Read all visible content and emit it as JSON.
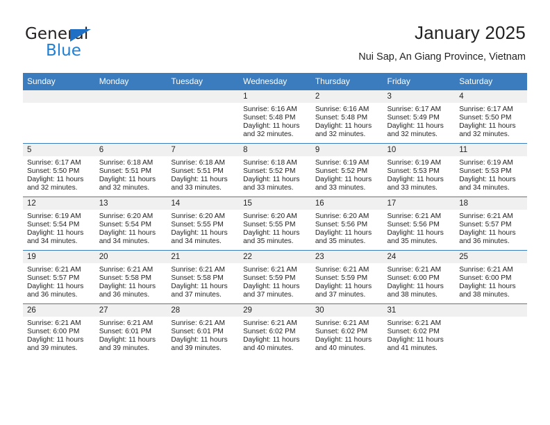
{
  "brand": {
    "name_top": "General",
    "name_bottom": "Blue",
    "triangle_color": "#1f6fc4",
    "blue_color": "#1f7fd4"
  },
  "header": {
    "title": "January 2025",
    "location": "Nui Sap, An Giang Province, Vietnam",
    "accent_color": "#3a7cbd"
  },
  "calendar": {
    "weekday_headers": [
      "Sunday",
      "Monday",
      "Tuesday",
      "Wednesday",
      "Thursday",
      "Friday",
      "Saturday"
    ],
    "labels": {
      "sunrise": "Sunrise:",
      "sunset": "Sunset:",
      "daylight": "Daylight:"
    },
    "weeks": [
      [
        {
          "day": "",
          "empty": true
        },
        {
          "day": "",
          "empty": true
        },
        {
          "day": "",
          "empty": true
        },
        {
          "day": "1",
          "sunrise": "Sunrise: 6:16 AM",
          "sunset": "Sunset: 5:48 PM",
          "daylight": "Daylight: 11 hours and 32 minutes."
        },
        {
          "day": "2",
          "sunrise": "Sunrise: 6:16 AM",
          "sunset": "Sunset: 5:48 PM",
          "daylight": "Daylight: 11 hours and 32 minutes."
        },
        {
          "day": "3",
          "sunrise": "Sunrise: 6:17 AM",
          "sunset": "Sunset: 5:49 PM",
          "daylight": "Daylight: 11 hours and 32 minutes."
        },
        {
          "day": "4",
          "sunrise": "Sunrise: 6:17 AM",
          "sunset": "Sunset: 5:50 PM",
          "daylight": "Daylight: 11 hours and 32 minutes."
        }
      ],
      [
        {
          "day": "5",
          "sunrise": "Sunrise: 6:17 AM",
          "sunset": "Sunset: 5:50 PM",
          "daylight": "Daylight: 11 hours and 32 minutes."
        },
        {
          "day": "6",
          "sunrise": "Sunrise: 6:18 AM",
          "sunset": "Sunset: 5:51 PM",
          "daylight": "Daylight: 11 hours and 32 minutes."
        },
        {
          "day": "7",
          "sunrise": "Sunrise: 6:18 AM",
          "sunset": "Sunset: 5:51 PM",
          "daylight": "Daylight: 11 hours and 33 minutes."
        },
        {
          "day": "8",
          "sunrise": "Sunrise: 6:18 AM",
          "sunset": "Sunset: 5:52 PM",
          "daylight": "Daylight: 11 hours and 33 minutes."
        },
        {
          "day": "9",
          "sunrise": "Sunrise: 6:19 AM",
          "sunset": "Sunset: 5:52 PM",
          "daylight": "Daylight: 11 hours and 33 minutes."
        },
        {
          "day": "10",
          "sunrise": "Sunrise: 6:19 AM",
          "sunset": "Sunset: 5:53 PM",
          "daylight": "Daylight: 11 hours and 33 minutes."
        },
        {
          "day": "11",
          "sunrise": "Sunrise: 6:19 AM",
          "sunset": "Sunset: 5:53 PM",
          "daylight": "Daylight: 11 hours and 34 minutes."
        }
      ],
      [
        {
          "day": "12",
          "sunrise": "Sunrise: 6:19 AM",
          "sunset": "Sunset: 5:54 PM",
          "daylight": "Daylight: 11 hours and 34 minutes."
        },
        {
          "day": "13",
          "sunrise": "Sunrise: 6:20 AM",
          "sunset": "Sunset: 5:54 PM",
          "daylight": "Daylight: 11 hours and 34 minutes."
        },
        {
          "day": "14",
          "sunrise": "Sunrise: 6:20 AM",
          "sunset": "Sunset: 5:55 PM",
          "daylight": "Daylight: 11 hours and 34 minutes."
        },
        {
          "day": "15",
          "sunrise": "Sunrise: 6:20 AM",
          "sunset": "Sunset: 5:55 PM",
          "daylight": "Daylight: 11 hours and 35 minutes."
        },
        {
          "day": "16",
          "sunrise": "Sunrise: 6:20 AM",
          "sunset": "Sunset: 5:56 PM",
          "daylight": "Daylight: 11 hours and 35 minutes."
        },
        {
          "day": "17",
          "sunrise": "Sunrise: 6:21 AM",
          "sunset": "Sunset: 5:56 PM",
          "daylight": "Daylight: 11 hours and 35 minutes."
        },
        {
          "day": "18",
          "sunrise": "Sunrise: 6:21 AM",
          "sunset": "Sunset: 5:57 PM",
          "daylight": "Daylight: 11 hours and 36 minutes."
        }
      ],
      [
        {
          "day": "19",
          "sunrise": "Sunrise: 6:21 AM",
          "sunset": "Sunset: 5:57 PM",
          "daylight": "Daylight: 11 hours and 36 minutes."
        },
        {
          "day": "20",
          "sunrise": "Sunrise: 6:21 AM",
          "sunset": "Sunset: 5:58 PM",
          "daylight": "Daylight: 11 hours and 36 minutes."
        },
        {
          "day": "21",
          "sunrise": "Sunrise: 6:21 AM",
          "sunset": "Sunset: 5:58 PM",
          "daylight": "Daylight: 11 hours and 37 minutes."
        },
        {
          "day": "22",
          "sunrise": "Sunrise: 6:21 AM",
          "sunset": "Sunset: 5:59 PM",
          "daylight": "Daylight: 11 hours and 37 minutes."
        },
        {
          "day": "23",
          "sunrise": "Sunrise: 6:21 AM",
          "sunset": "Sunset: 5:59 PM",
          "daylight": "Daylight: 11 hours and 37 minutes."
        },
        {
          "day": "24",
          "sunrise": "Sunrise: 6:21 AM",
          "sunset": "Sunset: 6:00 PM",
          "daylight": "Daylight: 11 hours and 38 minutes."
        },
        {
          "day": "25",
          "sunrise": "Sunrise: 6:21 AM",
          "sunset": "Sunset: 6:00 PM",
          "daylight": "Daylight: 11 hours and 38 minutes."
        }
      ],
      [
        {
          "day": "26",
          "sunrise": "Sunrise: 6:21 AM",
          "sunset": "Sunset: 6:00 PM",
          "daylight": "Daylight: 11 hours and 39 minutes."
        },
        {
          "day": "27",
          "sunrise": "Sunrise: 6:21 AM",
          "sunset": "Sunset: 6:01 PM",
          "daylight": "Daylight: 11 hours and 39 minutes."
        },
        {
          "day": "28",
          "sunrise": "Sunrise: 6:21 AM",
          "sunset": "Sunset: 6:01 PM",
          "daylight": "Daylight: 11 hours and 39 minutes."
        },
        {
          "day": "29",
          "sunrise": "Sunrise: 6:21 AM",
          "sunset": "Sunset: 6:02 PM",
          "daylight": "Daylight: 11 hours and 40 minutes."
        },
        {
          "day": "30",
          "sunrise": "Sunrise: 6:21 AM",
          "sunset": "Sunset: 6:02 PM",
          "daylight": "Daylight: 11 hours and 40 minutes."
        },
        {
          "day": "31",
          "sunrise": "Sunrise: 6:21 AM",
          "sunset": "Sunset: 6:02 PM",
          "daylight": "Daylight: 11 hours and 41 minutes."
        },
        {
          "day": "",
          "empty": true
        }
      ]
    ]
  }
}
